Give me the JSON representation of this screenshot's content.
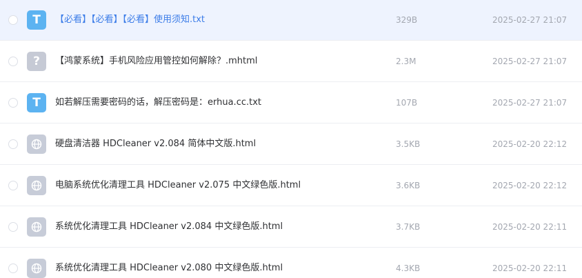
{
  "files": [
    {
      "name": "【必看】【必看】【必看】使用须知.txt",
      "size": "329B",
      "modified": "2025-02-27 21:07",
      "type_icon": "txt-file-icon",
      "selected": true
    },
    {
      "name": "【鸿蒙系统】手机风险应用管控如何解除？.mhtml",
      "size": "2.3M",
      "modified": "2025-02-27 21:07",
      "type_icon": "unknown-file-icon",
      "selected": false
    },
    {
      "name": "如若解压需要密码的话，解压密码是：erhua.cc.txt",
      "size": "107B",
      "modified": "2025-02-27 21:07",
      "type_icon": "txt-file-icon",
      "selected": false
    },
    {
      "name": "硬盘清洁器 HDCleaner v2.084 简体中文版.html",
      "size": "3.5KB",
      "modified": "2025-02-20 22:12",
      "type_icon": "html-file-icon",
      "selected": false
    },
    {
      "name": "电脑系统优化清理工具 HDCleaner v2.075 中文绿色版.html",
      "size": "3.6KB",
      "modified": "2025-02-20 22:12",
      "type_icon": "html-file-icon",
      "selected": false
    },
    {
      "name": "系统优化清理工具 HDCleaner v2.084 中文绿色版.html",
      "size": "3.7KB",
      "modified": "2025-02-20 22:11",
      "type_icon": "html-file-icon",
      "selected": false
    },
    {
      "name": "系统优化清理工具 HDCleaner v2.080 中文绿色版.html",
      "size": "4.3KB",
      "modified": "2025-02-20 22:11",
      "type_icon": "html-file-icon",
      "selected": false
    }
  ],
  "colors": {
    "selected_row_bg": "#eef3fe",
    "selected_text": "#3b7ce8",
    "txt_icon_bg": "#5cb3f1",
    "html_icon_bg": "#c7ccd8",
    "meta_text": "#a3a7b0"
  }
}
